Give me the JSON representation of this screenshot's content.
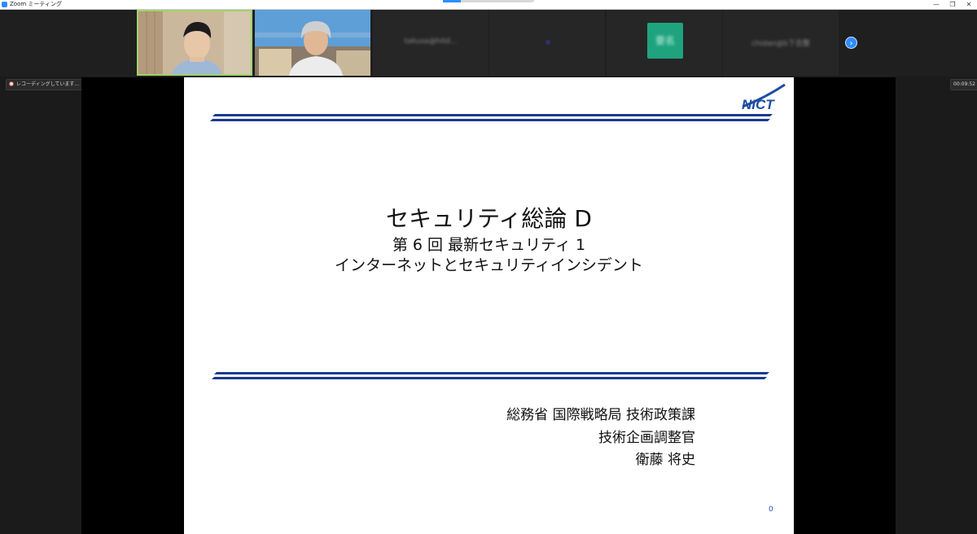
{
  "window": {
    "title": "Zoom ミーティング",
    "controls": [
      "—",
      "❐",
      "✕"
    ]
  },
  "participants": [
    {
      "kind": "video",
      "description": "participant-1"
    },
    {
      "kind": "video",
      "description": "participant-2"
    },
    {
      "kind": "name",
      "name": "takusa@hitd..."
    },
    {
      "kind": "dot"
    },
    {
      "kind": "avatar",
      "initials": "要名"
    },
    {
      "kind": "name",
      "name": "chidan@b下吉整"
    }
  ],
  "strip": {
    "next_icon": "chevron-right-icon",
    "next_label": "›"
  },
  "recording": {
    "label": "レコーディングしています...",
    "icon": "recording-cloud-icon"
  },
  "timer": {
    "value": "00:09:52"
  },
  "slide": {
    "title": "セキュリティ総論 D",
    "subtitle_line1": "第 6 回 最新セキュリティ 1",
    "subtitle_line2": "インターネットとセキュリティインシデント",
    "affiliation_line1": "総務省 国際戦略局 技術政策課",
    "affiliation_line2": "技術企画調整官",
    "affiliation_line3": "衛藤 将史",
    "page_number": "0",
    "logo_text": "NICT",
    "colors": {
      "stripe": "#1a3a8f",
      "logo": "#1f4da3"
    }
  }
}
